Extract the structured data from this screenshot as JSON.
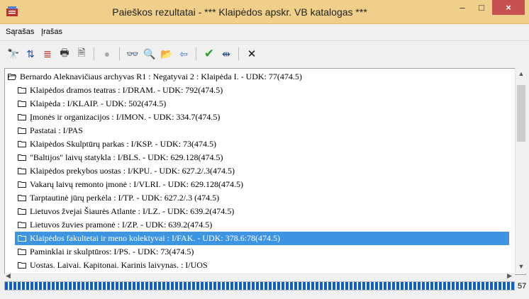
{
  "window": {
    "title": "Paieškos rezultatai - *** Klaipėdos apskr. VB katalogas ***",
    "controls": {
      "minimize": "–",
      "maximize": "□",
      "close": "×"
    },
    "colors": {
      "titlebar": "#f0cf8a",
      "close_button": "#c75050",
      "selection": "#3d95e2",
      "progress": "#0c5fd6"
    }
  },
  "menu": {
    "items": [
      {
        "label": "Sąrašas"
      },
      {
        "label": "Įrašas"
      }
    ]
  },
  "toolbar": {
    "buttons": [
      {
        "icon": "find-icon",
        "glyph": "🔭"
      },
      {
        "icon": "sort-az-icon",
        "glyph": "⇅"
      },
      {
        "icon": "sort-list-icon",
        "glyph": "≣"
      },
      {
        "icon": "print-icon",
        "glyph": "🖶"
      },
      {
        "icon": "print-preview-icon",
        "glyph": "🗎"
      },
      {
        "icon": "stop-icon",
        "glyph": "●"
      },
      {
        "icon": "glasses-icon",
        "glyph": "👓"
      },
      {
        "icon": "binoculars-icon",
        "glyph": "🔍"
      },
      {
        "icon": "open-folder-icon",
        "glyph": "📂"
      },
      {
        "icon": "export-icon",
        "glyph": "⇦"
      },
      {
        "icon": "checkmark-icon",
        "glyph": "✔"
      },
      {
        "icon": "fit-width-icon",
        "glyph": "⇹"
      },
      {
        "icon": "close-icon",
        "glyph": "✕"
      }
    ]
  },
  "tree": {
    "root": "Bernardo Aleknavičiaus archyvas R1 : Negatyvai 2 : Klaipėda I. - UDK: 77(474.5)",
    "children": [
      "Klaipėdos dramos teatras : I/DRAM. - UDK: 792(474.5)",
      "Klaipėda : I/KLAIP. - UDK: 502(474.5)",
      "Įmonės ir organizacijos : I/IMON. - UDK: 334.7(474.5)",
      "Pastatai : I/PAS",
      "Klaipėdos Skulptūrų parkas : I/KSP. - UDK: 73(474.5)",
      "\"Baltijos\" laivų statykla : I/BLS. - UDK: 629.128(474.5)",
      "Klaipėdos prekybos uostas : I/KPU. - UDK: 627.2/.3(474.5)",
      "Vakarų laivų remonto įmonė : I/VLRI. - UDK: 629.128(474.5)",
      "Tarptautinė jūrų perkėla : I/TP. - UDK: 627.2/.3 (474.5)",
      "Lietuvos žvejai Šiaurės Atlante : I/LZ. - UDK: 639.2(474.5)",
      "Lietuvos žuvies pramonė : I/ZP. - UDK: 639.2(474.5)",
      "Klaipėdos fakultetai ir meno kolektyvai : I/FAK. - UDK: 378.6:78(474.5)",
      "Paminklai ir skulptūros: I/PS. - UDK: 73(474.5)",
      "Uostas. Laivai. Kapitonai. Karinis laivynas. : I/UOS"
    ],
    "selected_index": 11
  },
  "status": {
    "count": "57",
    "progress": 1.0
  }
}
